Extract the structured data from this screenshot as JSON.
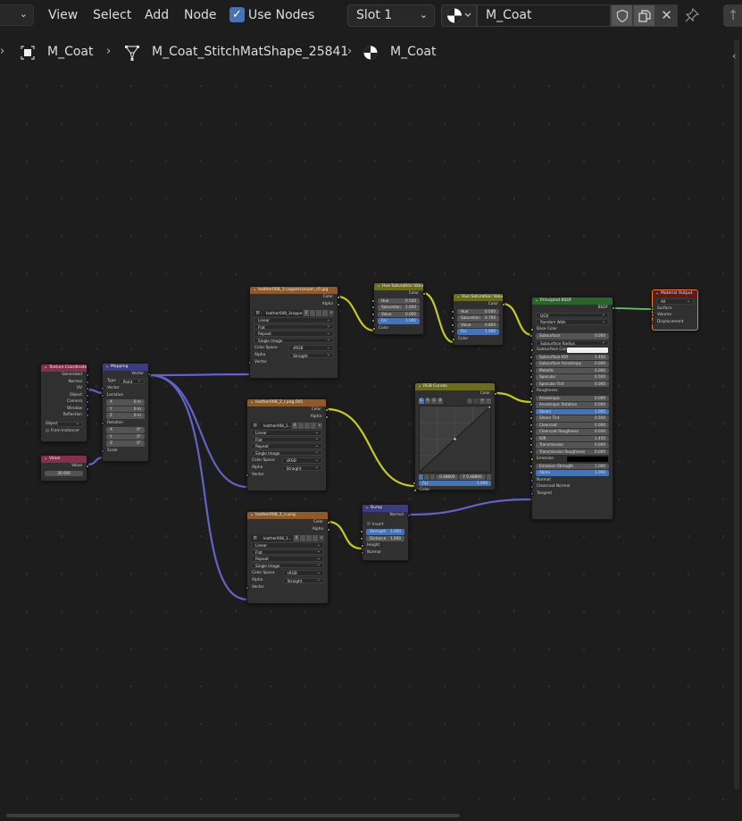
{
  "header": {
    "menus": [
      "View",
      "Select",
      "Add",
      "Node"
    ],
    "use_nodes_label": "Use Nodes",
    "use_nodes_checked": true,
    "slot_label": "Slot 1",
    "material_name": "M_Coat",
    "icons": {
      "editor_type": "dropdown-chevron-icon",
      "material_browse": "material-sphere-icon",
      "fake_user": "shield-icon",
      "duplicate": "duplicate-icon",
      "unlink": "close-icon",
      "pin": "pin-icon",
      "parent": "arrow-up-icon"
    }
  },
  "breadcrumb": {
    "items": [
      {
        "label": "M_Coat",
        "icon": "object-icon"
      },
      {
        "label": "M_Coat_StitchMatShape_25841",
        "icon": "mesh-icon"
      },
      {
        "label": "M_Coat",
        "icon": "material-sphere-icon"
      }
    ]
  },
  "nodes": {
    "texcoord": {
      "title": "Texture Coordinate",
      "outputs": [
        "Generated",
        "Normal",
        "UV",
        "Object",
        "Camera",
        "Window",
        "Reflection"
      ],
      "object_label": "Object:",
      "from_instancer": "From Instancer"
    },
    "value": {
      "title": "Value",
      "output": "Value",
      "value": "30.000"
    },
    "mapping": {
      "title": "Mapping",
      "output": "Vector",
      "type_label": "Type",
      "type_value": "Point",
      "inputs": [
        "Vector",
        "Location",
        "Rotation",
        "Scale"
      ],
      "location": [
        {
          "axis": "X",
          "val": "0 m"
        },
        {
          "axis": "Y",
          "val": "0 m"
        },
        {
          "axis": "Z",
          "val": "0 m"
        }
      ],
      "rotation": [
        {
          "axis": "X",
          "val": "0°"
        },
        {
          "axis": "Y",
          "val": "0°"
        },
        {
          "axis": "Z",
          "val": "0°"
        }
      ]
    },
    "img1": {
      "title": "leather008_3.coppercanyon_r0.jpg",
      "outputs": [
        "Color",
        "Alpha"
      ],
      "image_name": "leather008_3coppe...",
      "users": "2",
      "interp": "Linear",
      "proj": "Flat",
      "ext": "Repeat",
      "source": "Single Image",
      "colorspace_label": "Color Space",
      "colorspace": "sRGB",
      "alpha_label": "Alpha",
      "alpha": "Straight",
      "input": "Vector"
    },
    "img2": {
      "title": "leather008_2_r.png.001",
      "outputs": [
        "Color",
        "Alpha"
      ],
      "image_name": "leather008_2...",
      "users": "4",
      "interp": "Linear",
      "proj": "Flat",
      "ext": "Repeat",
      "source": "Single Image",
      "colorspace_label": "Color Space",
      "colorspace": "sRGB",
      "alpha_label": "Alpha",
      "alpha": "Straight",
      "input": "Vector"
    },
    "img3": {
      "title": "leather008_1_n.png",
      "outputs": [
        "Color",
        "Alpha"
      ],
      "image_name": "leather008_1...",
      "users": "4",
      "interp": "Linear",
      "proj": "Flat",
      "ext": "Repeat",
      "source": "Single Image",
      "colorspace_label": "Color Space",
      "colorspace": "sRGB",
      "alpha_label": "Alpha",
      "alpha": "Straight",
      "input": "Vector"
    },
    "hsv1": {
      "title": "Hue Saturation Value",
      "output": "Color",
      "fields": [
        {
          "l": "Hue",
          "v": "0.500"
        },
        {
          "l": "Saturation",
          "v": "1.000"
        },
        {
          "l": "Value",
          "v": "0.000"
        },
        {
          "l": "Fac",
          "v": "1.000"
        }
      ],
      "input": "Color"
    },
    "hsv2": {
      "title": "Hue Saturation Value",
      "output": "Color",
      "fields": [
        {
          "l": "Hue",
          "v": "0.500"
        },
        {
          "l": "Saturation",
          "v": "0.700"
        },
        {
          "l": "Value",
          "v": "0.800"
        },
        {
          "l": "Fac",
          "v": "1.000"
        }
      ],
      "input": "Color"
    },
    "curves": {
      "title": "RGB Curves",
      "output": "Color",
      "channels": [
        "C",
        "R",
        "G",
        "B"
      ],
      "x_val": "0.48800",
      "y_val": "Y 0.48800",
      "fac_label": "Fac",
      "fac": "1.000",
      "input": "Color"
    },
    "bump": {
      "title": "Bump",
      "output": "Normal",
      "invert": "Invert",
      "fields": [
        {
          "l": "Strength",
          "v": "1.000"
        },
        {
          "l": "Distance",
          "v": "1.000"
        }
      ],
      "inputs": [
        "Height",
        "Normal"
      ]
    },
    "bsdf": {
      "title": "Principled BSDF",
      "output": "BSDF",
      "distribution": "GGX",
      "subsurface_method": "Random Walk",
      "base_color": "Base Color",
      "fields": [
        {
          "l": "Subsurface",
          "v": "0.000",
          "t": "f"
        },
        {
          "l": "Subsurface Radius",
          "v": "",
          "t": "dd"
        },
        {
          "l": "Subsurface Color",
          "v": "",
          "t": "color-white"
        },
        {
          "l": "Subsurface IOR",
          "v": "1.400",
          "t": "f"
        },
        {
          "l": "Subsurface Anisotropy",
          "v": "0.000",
          "t": "f"
        },
        {
          "l": "Metallic",
          "v": "0.000",
          "t": "f"
        },
        {
          "l": "Specular",
          "v": "0.500",
          "t": "f"
        },
        {
          "l": "Specular Tint",
          "v": "0.000",
          "t": "f"
        },
        {
          "l": "Roughness",
          "v": "",
          "t": "label"
        },
        {
          "l": "Anisotropic",
          "v": "0.000",
          "t": "f"
        },
        {
          "l": "Anisotropic Rotation",
          "v": "0.000",
          "t": "f"
        },
        {
          "l": "Sheen",
          "v": "1.000",
          "t": "blue"
        },
        {
          "l": "Sheen Tint",
          "v": "0.500",
          "t": "f"
        },
        {
          "l": "Clearcoat",
          "v": "0.000",
          "t": "f"
        },
        {
          "l": "Clearcoat Roughness",
          "v": "0.030",
          "t": "f"
        },
        {
          "l": "IOR",
          "v": "1.450",
          "t": "f"
        },
        {
          "l": "Transmission",
          "v": "0.000",
          "t": "f"
        },
        {
          "l": "Transmission Roughness",
          "v": "0.000",
          "t": "f"
        },
        {
          "l": "Emission",
          "v": "",
          "t": "color-black"
        },
        {
          "l": "Emission Strength",
          "v": "1.000",
          "t": "f"
        },
        {
          "l": "Alpha",
          "v": "1.000",
          "t": "blue"
        },
        {
          "l": "Normal",
          "v": "",
          "t": "label"
        },
        {
          "l": "Clearcoat Normal",
          "v": "",
          "t": "label"
        },
        {
          "l": "Tangent",
          "v": "",
          "t": "label"
        }
      ]
    },
    "output": {
      "title": "Material Output",
      "target": "All",
      "inputs": [
        "Surface",
        "Volume",
        "Displacement"
      ]
    }
  },
  "colors": {
    "texture_header": "#8f5a2a",
    "input_header": "#83314a",
    "vector_header": "#3c3c83",
    "color_header": "#6c6c1e",
    "shader_header": "#2b652b",
    "output_header": "#5c1a1a",
    "output_border": "#ee7a2c",
    "wire_color": "#c7c729",
    "wire_vector": "#6363c7",
    "wire_shader": "#63c763",
    "accent_blue": "#4772b3"
  }
}
